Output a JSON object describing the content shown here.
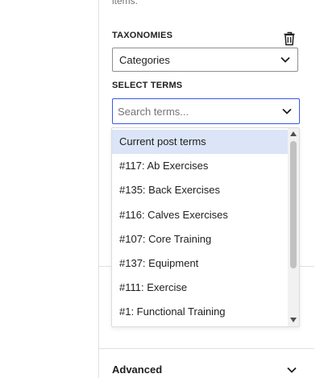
{
  "help_text": "items.",
  "taxonomies": {
    "label": "TAXONOMIES",
    "selected": "Categories",
    "delete_icon": "trash-icon"
  },
  "select_terms": {
    "label": "SELECT TERMS",
    "search_placeholder": "Search terms...",
    "search_value": ""
  },
  "dropdown": {
    "options": [
      "Current post terms",
      "#117: Ab Exercises",
      "#135: Back Exercises",
      "#116: Calves Exercises",
      "#107: Core Training",
      "#137: Equipment",
      "#111: Exercise",
      "#1: Functional Training"
    ],
    "highlighted_index": 0
  },
  "advanced": {
    "label": "Advanced"
  },
  "colors": {
    "accent": "#3858e9",
    "highlight": "#dbe5f7",
    "border": "#8c8f94"
  }
}
